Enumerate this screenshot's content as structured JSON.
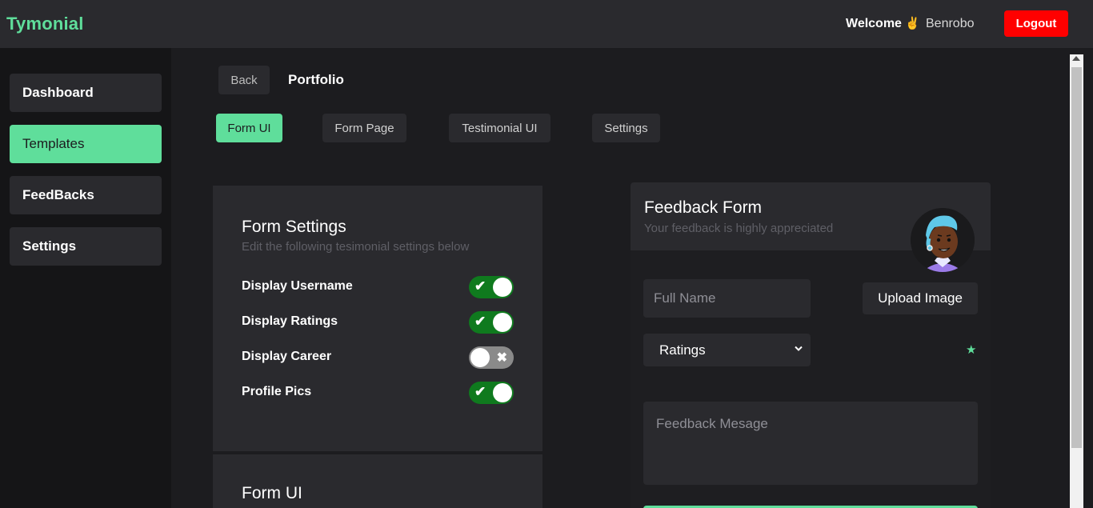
{
  "header": {
    "brand": "Tymonial",
    "welcome_label": "Welcome",
    "wave_emoji": "✌",
    "username": "Benrobo",
    "logout_label": "Logout"
  },
  "sidebar": {
    "items": [
      {
        "label": "Dashboard",
        "active": false
      },
      {
        "label": "Templates",
        "active": true
      },
      {
        "label": "FeedBacks",
        "active": false
      },
      {
        "label": "Settings",
        "active": false
      }
    ]
  },
  "breadcrumb": {
    "back_label": "Back",
    "current": "Portfolio"
  },
  "tabs": [
    {
      "label": "Form UI",
      "active": true
    },
    {
      "label": "Form Page",
      "active": false
    },
    {
      "label": "Testimonial UI",
      "active": false
    },
    {
      "label": "Settings",
      "active": false
    }
  ],
  "form_settings": {
    "title": "Form Settings",
    "subtitle": "Edit the following tesimonial settings below",
    "toggles": [
      {
        "label": "Display Username",
        "on": true
      },
      {
        "label": "Display Ratings",
        "on": true
      },
      {
        "label": "Display Career",
        "on": false
      },
      {
        "label": "Profile Pics",
        "on": true
      }
    ]
  },
  "form_ui": {
    "title": "Form UI"
  },
  "feedback_form": {
    "title": "Feedback Form",
    "subtitle": "Your feedback is highly appreciated",
    "full_name_placeholder": "Full Name",
    "upload_label": "Upload Image",
    "ratings_label": "Ratings",
    "message_placeholder": "Feedback Mesage"
  },
  "colors": {
    "accent": "#5fde9b",
    "danger": "#ff0000",
    "toggle_on": "#0f7a1e",
    "toggle_off": "#8a8a8a",
    "surface": "#2a2a2e",
    "background": "#1c1c1f"
  },
  "icons": {
    "check": "check-icon",
    "cross": "x-icon",
    "star": "star-icon",
    "chevron": "chevron-down-icon"
  }
}
